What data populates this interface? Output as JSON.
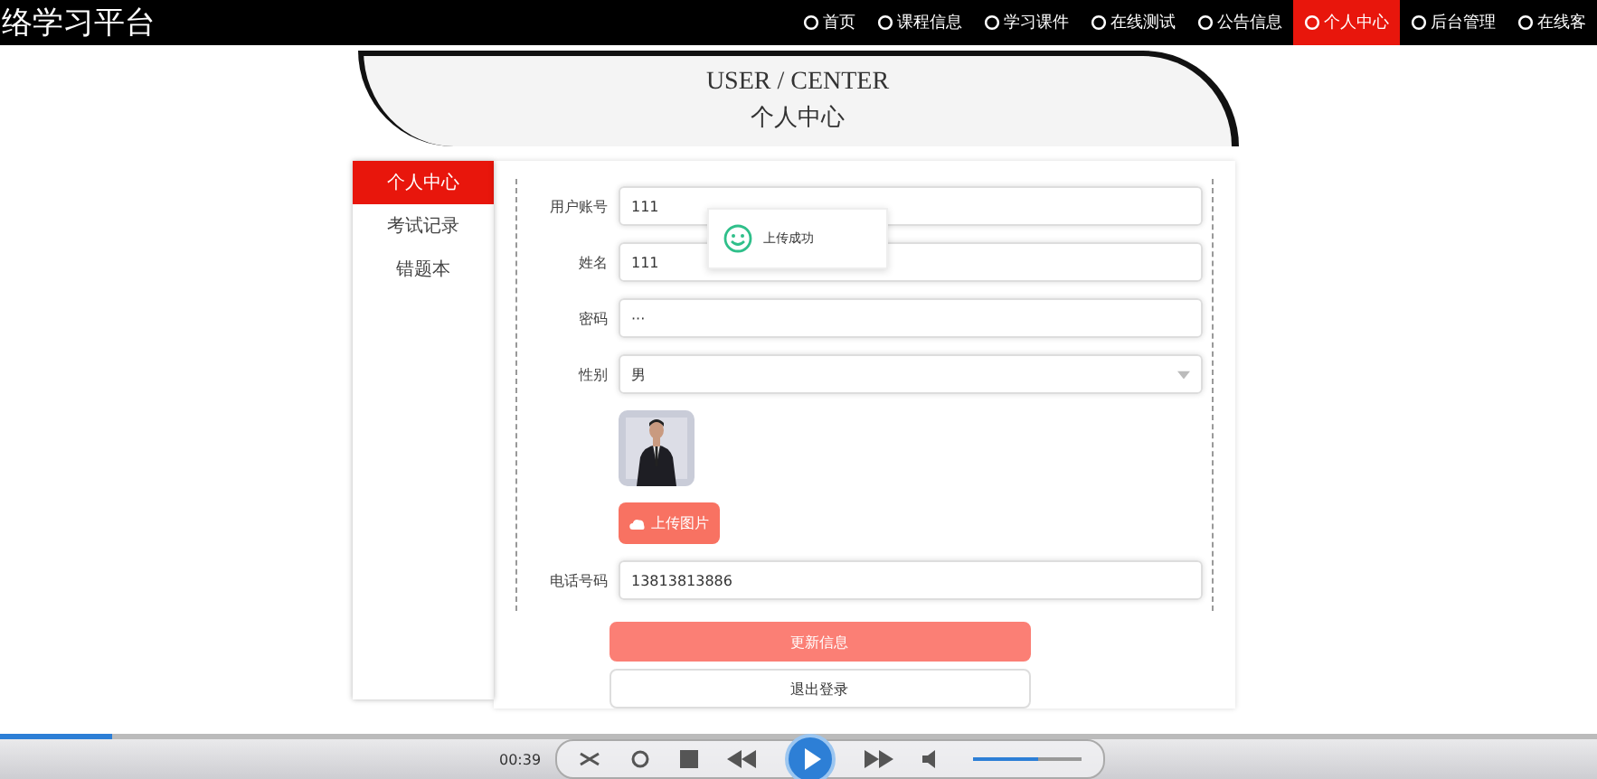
{
  "site_title": "络学习平台",
  "nav": [
    {
      "label": "首页",
      "selected": false
    },
    {
      "label": "课程信息",
      "selected": false
    },
    {
      "label": "学习课件",
      "selected": false
    },
    {
      "label": "在线测试",
      "selected": false
    },
    {
      "label": "公告信息",
      "selected": false
    },
    {
      "label": "个人中心",
      "selected": true
    },
    {
      "label": "后台管理",
      "selected": false
    },
    {
      "label": "在线客",
      "selected": false
    }
  ],
  "header": {
    "title_en": "USER / CENTER",
    "title_cn": "个人中心"
  },
  "sidebar": [
    {
      "label": "个人中心",
      "selected": true
    },
    {
      "label": "考试记录",
      "selected": false
    },
    {
      "label": "错题本",
      "selected": false
    }
  ],
  "form": [
    {
      "kind": "text",
      "label": "用户账号",
      "value": "111"
    },
    {
      "kind": "text",
      "label": "姓名",
      "value": "111"
    },
    {
      "kind": "password",
      "label": "密码",
      "value": "···"
    },
    {
      "kind": "select",
      "label": "性别",
      "value": "男"
    },
    {
      "label": "上传图片"
    },
    {
      "kind": "text",
      "label": "电话号码",
      "value": "13813813886"
    }
  ],
  "toast": "上传成功",
  "buttons": [
    {
      "kind": "primary",
      "label": "更新信息"
    },
    {
      "kind": "plain",
      "label": "退出登录"
    }
  ],
  "player": {
    "time": "00:39",
    "level": 0.07,
    "volume": {
      "level": 0.6
    }
  }
}
